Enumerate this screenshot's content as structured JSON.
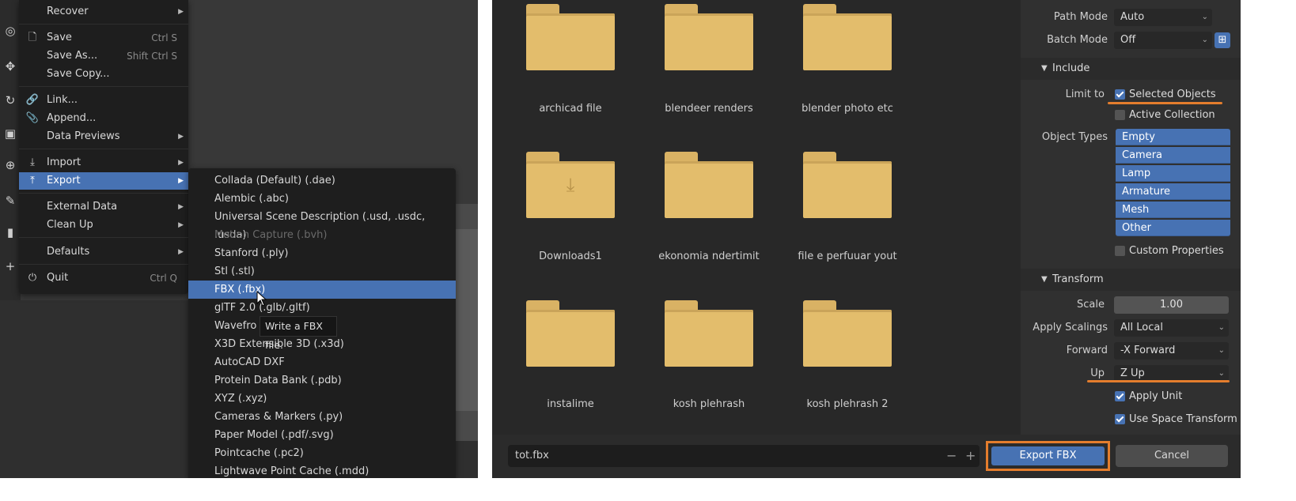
{
  "left": {
    "file_menu": {
      "items": [
        {
          "label": "Recover",
          "shortcut": "",
          "icon": "",
          "submenu": true
        },
        {
          "label": "Save",
          "shortcut": "Ctrl S",
          "icon": "save-icon",
          "submenu": false
        },
        {
          "label": "Save As...",
          "shortcut": "Shift Ctrl S",
          "icon": "",
          "submenu": false
        },
        {
          "label": "Save Copy...",
          "shortcut": "",
          "icon": "",
          "submenu": false
        },
        {
          "label": "Link...",
          "shortcut": "",
          "icon": "link-icon",
          "submenu": false
        },
        {
          "label": "Append...",
          "shortcut": "",
          "icon": "paperclip-icon",
          "submenu": false
        },
        {
          "label": "Data Previews",
          "shortcut": "",
          "icon": "",
          "submenu": true
        },
        {
          "label": "Import",
          "shortcut": "",
          "icon": "import-icon",
          "submenu": true
        },
        {
          "label": "Export",
          "shortcut": "",
          "icon": "export-icon",
          "submenu": true
        },
        {
          "label": "External Data",
          "shortcut": "",
          "icon": "",
          "submenu": true
        },
        {
          "label": "Clean Up",
          "shortcut": "",
          "icon": "",
          "submenu": true
        },
        {
          "label": "Defaults",
          "shortcut": "",
          "icon": "",
          "submenu": true
        },
        {
          "label": "Quit",
          "shortcut": "Ctrl Q",
          "icon": "power-icon",
          "submenu": false
        }
      ],
      "active": "Export"
    },
    "export_menu": {
      "items": [
        "Collada (Default) (.dae)",
        "Alembic (.abc)",
        "Universal Scene Description (.usd, .usdc, .usda)",
        "Motion Capture (.bvh)",
        "Stanford (.ply)",
        "Stl (.stl)",
        "FBX (.fbx)",
        "glTF 2.0 (.glb/.gltf)",
        "Wavefro",
        "X3D Extensible 3D (.x3d)",
        "AutoCAD DXF",
        "Protein Data Bank (.pdb)",
        "XYZ (.xyz)",
        "Cameras & Markers (.py)",
        "Paper Model (.pdf/.svg)",
        "Pointcache (.pc2)",
        "Lightwave Point Cache (.mdd)"
      ],
      "disabled": "Motion Capture (.bvh)",
      "active": "FBX (.fbx)",
      "tooltip": "Write a FBX file."
    }
  },
  "right": {
    "folders": [
      {
        "name": "archicad file",
        "icon": "folder-icon"
      },
      {
        "name": "blendeer renders",
        "icon": "folder-icon"
      },
      {
        "name": "blender photo etc",
        "icon": "folder-icon"
      },
      {
        "name": "Downloads1",
        "icon": "download-folder-icon"
      },
      {
        "name": "ekonomia ndertimit",
        "icon": "folder-icon"
      },
      {
        "name": "file e perfuuar yout",
        "icon": "folder-icon"
      },
      {
        "name": "instalime",
        "icon": "folder-icon"
      },
      {
        "name": "kosh plehrash",
        "icon": "folder-icon"
      },
      {
        "name": "kosh plehrash 2",
        "icon": "folder-icon"
      }
    ],
    "filename": "tot.fbx",
    "export_button": "Export FBX",
    "cancel_button": "Cancel",
    "options": {
      "path_mode_label": "Path Mode",
      "path_mode_value": "Auto",
      "batch_mode_label": "Batch Mode",
      "batch_mode_value": "Off",
      "include_section": "Include",
      "limit_to_label": "Limit to",
      "selected_objects": "Selected Objects",
      "active_collection": "Active Collection",
      "object_types_label": "Object Types",
      "object_types": [
        "Empty",
        "Camera",
        "Lamp",
        "Armature",
        "Mesh",
        "Other"
      ],
      "custom_properties": "Custom Properties",
      "transform_section": "Transform",
      "scale_label": "Scale",
      "scale_value": "1.00",
      "apply_scalings_label": "Apply Scalings",
      "apply_scalings_value": "All Local",
      "forward_label": "Forward",
      "forward_value": "-X Forward",
      "up_label": "Up",
      "up_value": "Z Up",
      "apply_unit": "Apply Unit",
      "use_space_transform": "Use Space Transform"
    },
    "checkbox_state": {
      "selected_objects": true,
      "active_collection": false,
      "custom_properties": false,
      "apply_unit": true,
      "use_space_transform": true
    },
    "highlight_color": "#e47d2d",
    "accent_color": "#4772b3"
  }
}
